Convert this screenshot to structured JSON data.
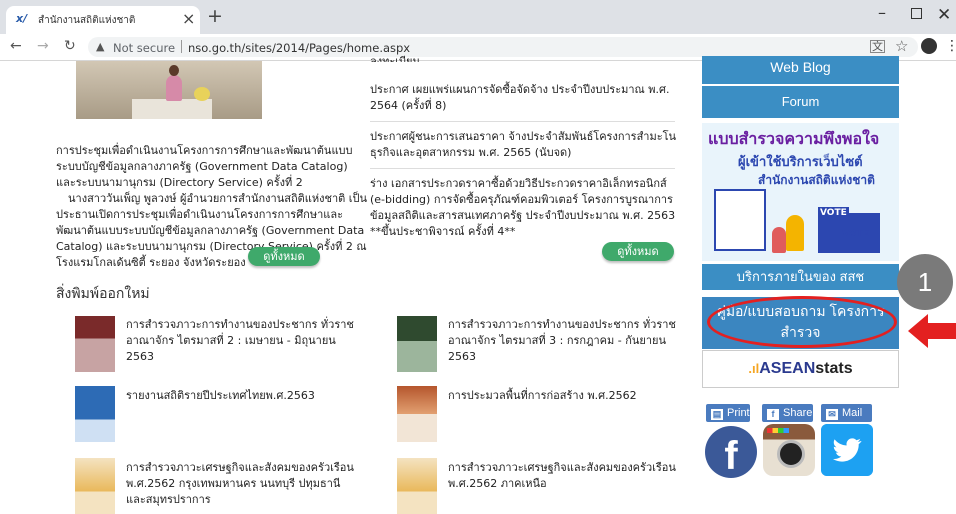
{
  "browser": {
    "tab_title": "สำนักงานสถิติแห่งชาติ",
    "url_prefix": "Not secure",
    "url": "nso.go.th/sites/2014/Pages/home.aspx",
    "favicon_text": "x/"
  },
  "news": {
    "title": "การประชุมเพื่อดำเนินงานโครงการการศึกษาและพัฒนาต้นแบบระบบบัญชีข้อมูลกลางภาครัฐ (Government Data Catalog) และระบบนามานุกรม (Directory Service) ครั้งที่ 2",
    "body": "นางสาววันเพ็ญ พูลวงษ์ ผู้อำนวยการสำนักงานสถิติแห่งชาติ เป็นประธานเปิดการประชุมเพื่อดำเนินงานโครงการการศึกษาและพัฒนาต้นแบบระบบบัญชีข้อมูลกลางภาครัฐ (Government Data Catalog) และระบบนามานุกรม (Directory Service) ครั้งที่ 2 ณ โรงแรมโกลเด้นซิตี้ ระยอง จังหวัดระยอง",
    "more_label": "ดูทั้งหมด"
  },
  "announcements": {
    "top_fragment": "ลงทะเบียน",
    "items": [
      "ประกาศ เผยแพร่แผนการจัดซื้อจัดจ้าง ประจำปีงบประมาณ พ.ศ. 2564 (ครั้งที่ 8)",
      "ประกาศผู้ชนะการเสนอราคา จ้างประจำสัมพันธ์โครงการสำมะโนธุรกิจและอุตสาหกรรม พ.ศ. 2565 (นับจด)",
      "ร่าง เอกสารประกวดราคาซื้อด้วยวิธีประกวดราคาอิเล็กทรอนิกส์ (e-bidding) การจัดซื้อครุภัณฑ์คอมพิวเตอร์ โครงการบูรณาการข้อมูลสถิติและสารสนเทศภาครัฐ ประจำปีงบประมาณ พ.ศ. 2563 **ขึ้นประชาพิจารณ์ ครั้งที่ 4**"
    ],
    "more_label": "ดูทั้งหมด"
  },
  "publications": {
    "heading": "สิ่งพิมพ์ออกใหม่",
    "items": [
      "การสำรวจภาวะการทำงานของประชากร ทั่วราชอาณาจักร ไตรมาสที่ 2 : เมษายน - มิถุนายน 2563",
      "การสำรวจภาวะการทำงานของประชากร ทั่วราชอาณาจักร ไตรมาสที่ 3 : กรกฎาคม - กันยายน 2563",
      "รายงานสถิติรายปีประเทศไทยพ.ศ.2563",
      "การประมวลพื้นที่การก่อสร้าง พ.ศ.2562",
      "การสำรวจภาวะเศรษฐกิจและสังคมของครัวเรือน พ.ศ.2562 กรุงเทพมหานคร นนทบุรี ปทุมธานี และสมุทรปราการ",
      "การสำรวจภาวะเศรษฐกิจและสังคมของครัวเรือน พ.ศ.2562 ภาคเหนือ"
    ]
  },
  "sidebar": {
    "web_blog": "Web Blog",
    "forum": "Forum",
    "survey_banner": {
      "line1": "แบบสำรวจความพึงพอใจ",
      "line2": "ผู้เข้าใช้บริการเว็บไซต์",
      "line3": "สำนักงานสถิติแห่งชาติ",
      "vote": "VOTE"
    },
    "internal_service": "บริการภายในของ สสช",
    "manual_line1": "คู่มือ/แบบสอบถาม โครงการ",
    "manual_line2": "สำรวจ",
    "asean_mark": ".ıl",
    "asean_a": "ASEAN",
    "asean_b": "stats",
    "print": "Print",
    "share": "Share",
    "mail": "Mail",
    "facebook_letter": "f"
  },
  "annotation": {
    "badge": "1",
    "highlight_color": "#e32020"
  }
}
